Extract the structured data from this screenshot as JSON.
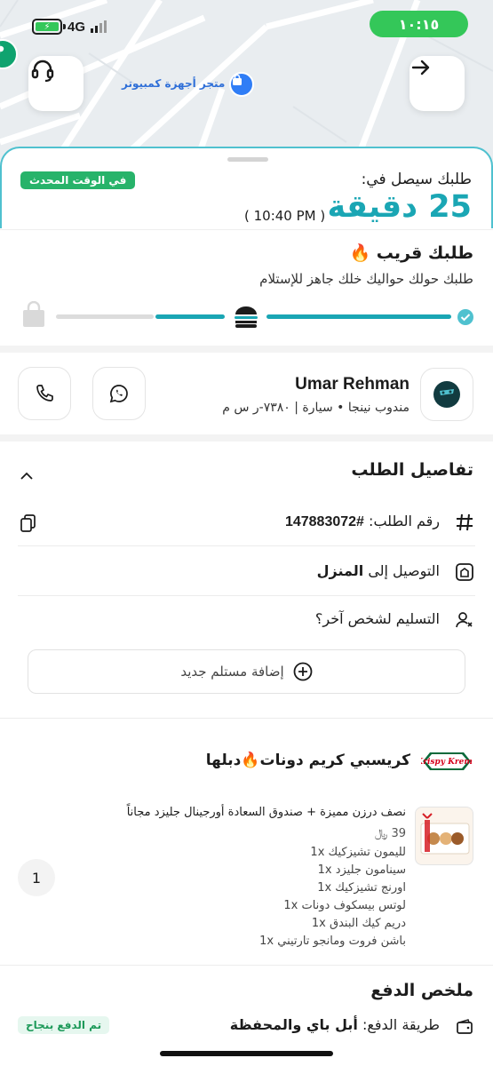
{
  "status_bar": {
    "network": "4G",
    "time": "١٠:١٥"
  },
  "map": {
    "store_label": "متجر أجهزة كمبيوتر"
  },
  "eta": {
    "subtitle": "طلبك سيصل في:",
    "minutes": "25 دقيقة",
    "clock": "( 10:40 PM )",
    "live_badge": "في الوقت المحدث"
  },
  "progress": {
    "title": "طلبك قريب 🔥",
    "description": "طلبك حولك حواليك خلك جاهز للإستلام"
  },
  "driver": {
    "name": "Umar Rehman",
    "info": "مندوب نينجا • سيارة | ٧٣٨٠-ر س م"
  },
  "order_details": {
    "title": "تفاصيل الطلب",
    "order_number_label": "رقم الطلب:",
    "order_number": "#147883072",
    "delivery_label": "التوصيل إلى",
    "delivery_target": "المنزل",
    "other_person": "التسليم لشخص آخر؟",
    "add_recipient": "إضافة مستلم جديد"
  },
  "restaurant": {
    "name": "كريسبي كريم دونات🔥دبلها",
    "logo_text": "Krispy Kreme"
  },
  "item": {
    "title": "نصف درزن مميزة + صندوق السعادة أورجينال جليزد مجاناً",
    "price": "39 ﷼",
    "quantity": "1",
    "addons": [
      "لليمون تشيزكيك  1x",
      "سينامون جليزد  1x",
      "اورنج تشيزكيك  1x",
      "لوتس بيسكوف دونات  1x",
      "دريم كيك البندق  1x",
      "باشن فروت ومانجو تارتيني  1x"
    ]
  },
  "payment": {
    "title": "ملخص الدفع",
    "method_label": "طريقة الدفع:",
    "method": "أبل باي والمحفظة",
    "status": "تم الدفع بنجاح"
  },
  "colors": {
    "accent": "#1aa6b4",
    "green": "#34c759",
    "badge_green": "#27b36a"
  }
}
